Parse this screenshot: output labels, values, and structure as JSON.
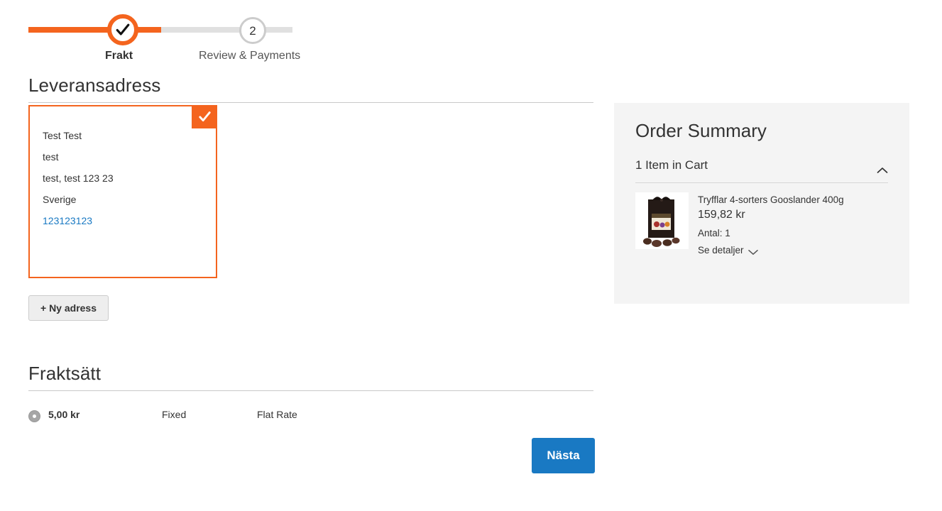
{
  "progress": {
    "steps": [
      {
        "label": "Frakt",
        "state": "completed",
        "icon": "check-icon"
      },
      {
        "label": "Review & Payments",
        "state": "upcoming",
        "number": "2"
      }
    ],
    "accent_color": "#f4641e",
    "track_color": "#e0e0e0"
  },
  "shipping_address": {
    "section_title": "Leveransadress",
    "selected_badge_icon": "check-icon",
    "lines": [
      "Test Test",
      "test",
      "test, test 123 23",
      "Sverige"
    ],
    "phone": "123123123",
    "phone_color": "#1979c3",
    "new_address_button": "+ Ny adress"
  },
  "shipping_methods": {
    "section_title": "Fraktsätt",
    "rows": [
      {
        "selected": true,
        "price": "5,00 kr",
        "carrier": "Fixed",
        "method": "Flat Rate"
      }
    ]
  },
  "actions": {
    "next_button": "Nästa",
    "next_button_color": "#1979c3"
  },
  "order_summary": {
    "title": "Order Summary",
    "cart_header": "1 Item in Cart",
    "cart_toggle_icon": "chevron-up-icon",
    "panel_color": "#f4f4f4",
    "items": [
      {
        "thumbnail_icon": "product-thumbnail",
        "name": "Tryfflar 4-sorters Gooslander 400g",
        "price": "159,82 kr",
        "qty_label": "Antal: 1",
        "details_label": "Se detaljer",
        "details_icon": "chevron-down-icon"
      }
    ]
  }
}
